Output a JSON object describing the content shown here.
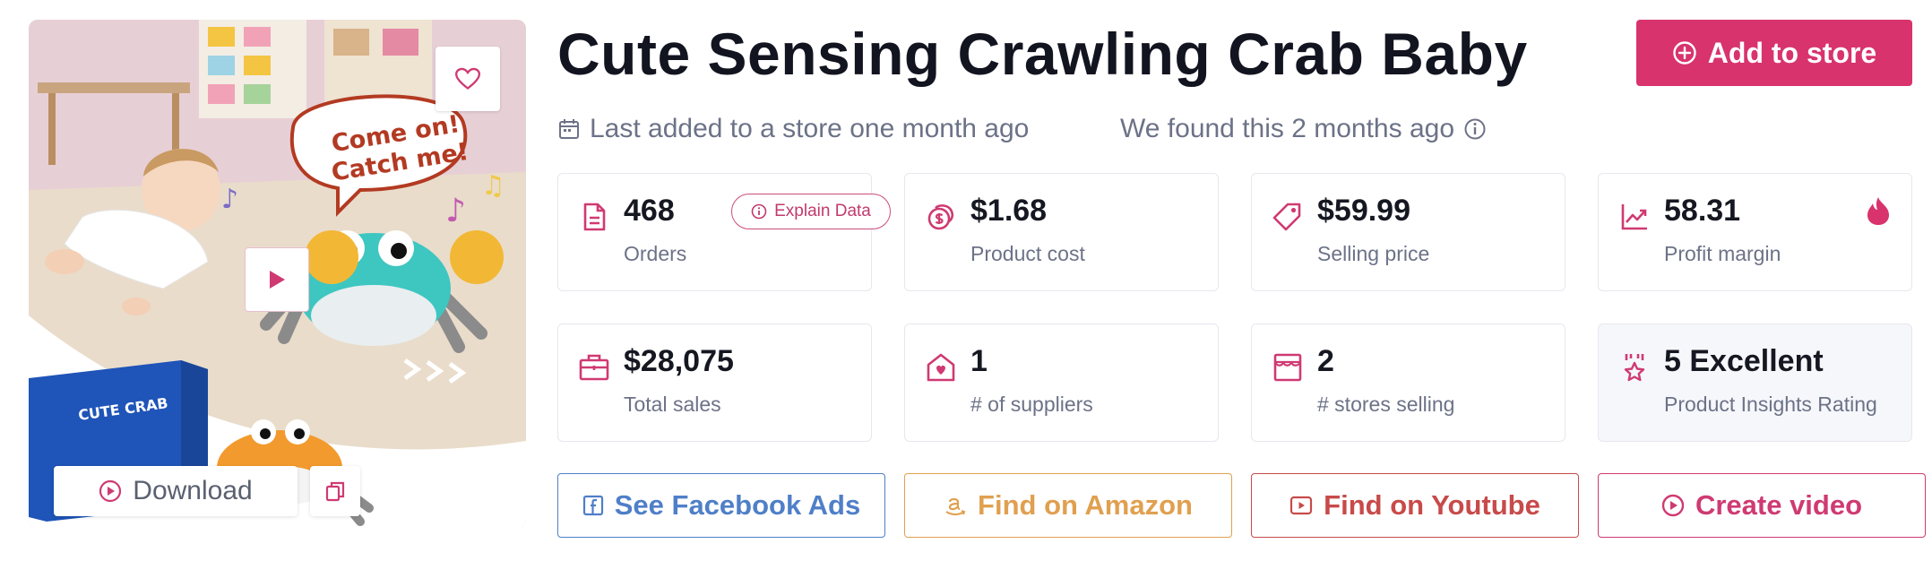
{
  "product": {
    "title": "Cute Sensing Crawling Crab Baby",
    "image_bubble_text": "Come on! Catch me!",
    "image_box_text": "CUTE CRAB"
  },
  "media": {
    "download_label": "Download",
    "favorite_icon": "heart-icon",
    "play_icon": "play-icon",
    "copy_icon": "copy-icon"
  },
  "header": {
    "add_to_store_label": "Add to store",
    "last_added": "Last added to a store one month ago",
    "found": "We found this 2 months ago"
  },
  "stats": {
    "orders": {
      "value": "468",
      "label": "Orders",
      "icon": "document-icon"
    },
    "explain_label": "Explain Data",
    "product_cost": {
      "value": "$1.68",
      "label": "Product cost",
      "icon": "coins-icon"
    },
    "selling_price": {
      "value": "$59.99",
      "label": "Selling price",
      "icon": "tag-icon"
    },
    "profit_margin": {
      "value": "58.31",
      "label": "Profit margin",
      "icon": "trend-chart-icon"
    },
    "total_sales": {
      "value": "$28,075",
      "label": "Total sales",
      "icon": "briefcase-icon"
    },
    "suppliers": {
      "value": "1",
      "label": "# of suppliers",
      "icon": "supplier-house-icon"
    },
    "stores_selling": {
      "value": "2",
      "label": "# stores selling",
      "icon": "store-icon"
    },
    "rating": {
      "value": "5 Excellent",
      "label": "Product Insights Rating",
      "icon": "award-icon"
    }
  },
  "actions": {
    "facebook": "See Facebook Ads",
    "amazon": "Find on Amazon",
    "youtube": "Find on Youtube",
    "video": "Create video"
  },
  "colors": {
    "accent": "#d8336d",
    "facebook": "#4f7fc8",
    "amazon": "#e0a050",
    "youtube": "#c84a4a",
    "video": "#cf3a72"
  }
}
